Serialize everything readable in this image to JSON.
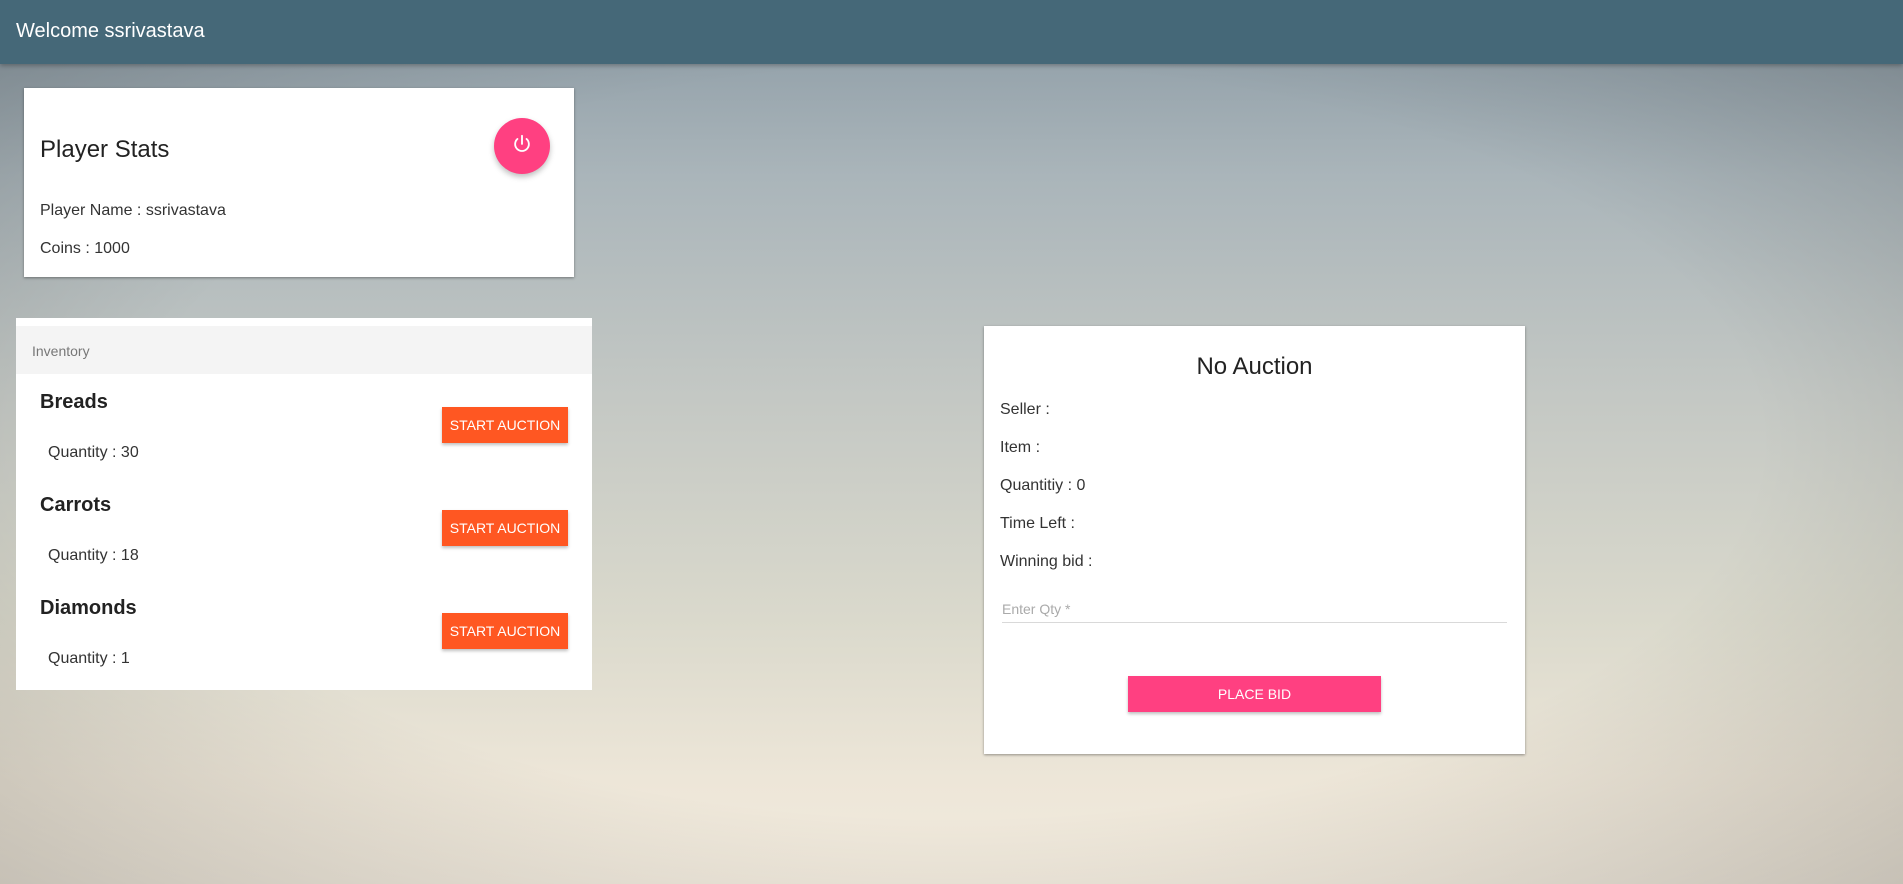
{
  "header": {
    "title": "Welcome ssrivastava"
  },
  "player_stats": {
    "heading": "Player Stats",
    "logout_icon": "power-icon",
    "player_name_text": "Player Name : ssrivastava",
    "coins_text": "Coins : 1000"
  },
  "inventory": {
    "header": "Inventory",
    "items": [
      {
        "name": "Breads",
        "quantity_text": "Quantity : 30",
        "button_label": "START AUCTION"
      },
      {
        "name": "Carrots",
        "quantity_text": "Quantity : 18",
        "button_label": "START AUCTION"
      },
      {
        "name": "Diamonds",
        "quantity_text": "Quantity : 1",
        "button_label": "START AUCTION"
      }
    ]
  },
  "auction": {
    "heading": "No Auction",
    "seller_text": "Seller :",
    "item_text": "Item :",
    "quantity_text": "Quantitiy : 0",
    "time_left_text": "Time Left :",
    "winning_bid_text": "Winning bid :",
    "qty_input": {
      "value": "",
      "placeholder": "Enter Qty *"
    },
    "place_bid_label": "PLACE BID"
  },
  "colors": {
    "topbar": "#456878",
    "accent_pink": "#ff4081",
    "accent_orange": "#ff5722"
  }
}
